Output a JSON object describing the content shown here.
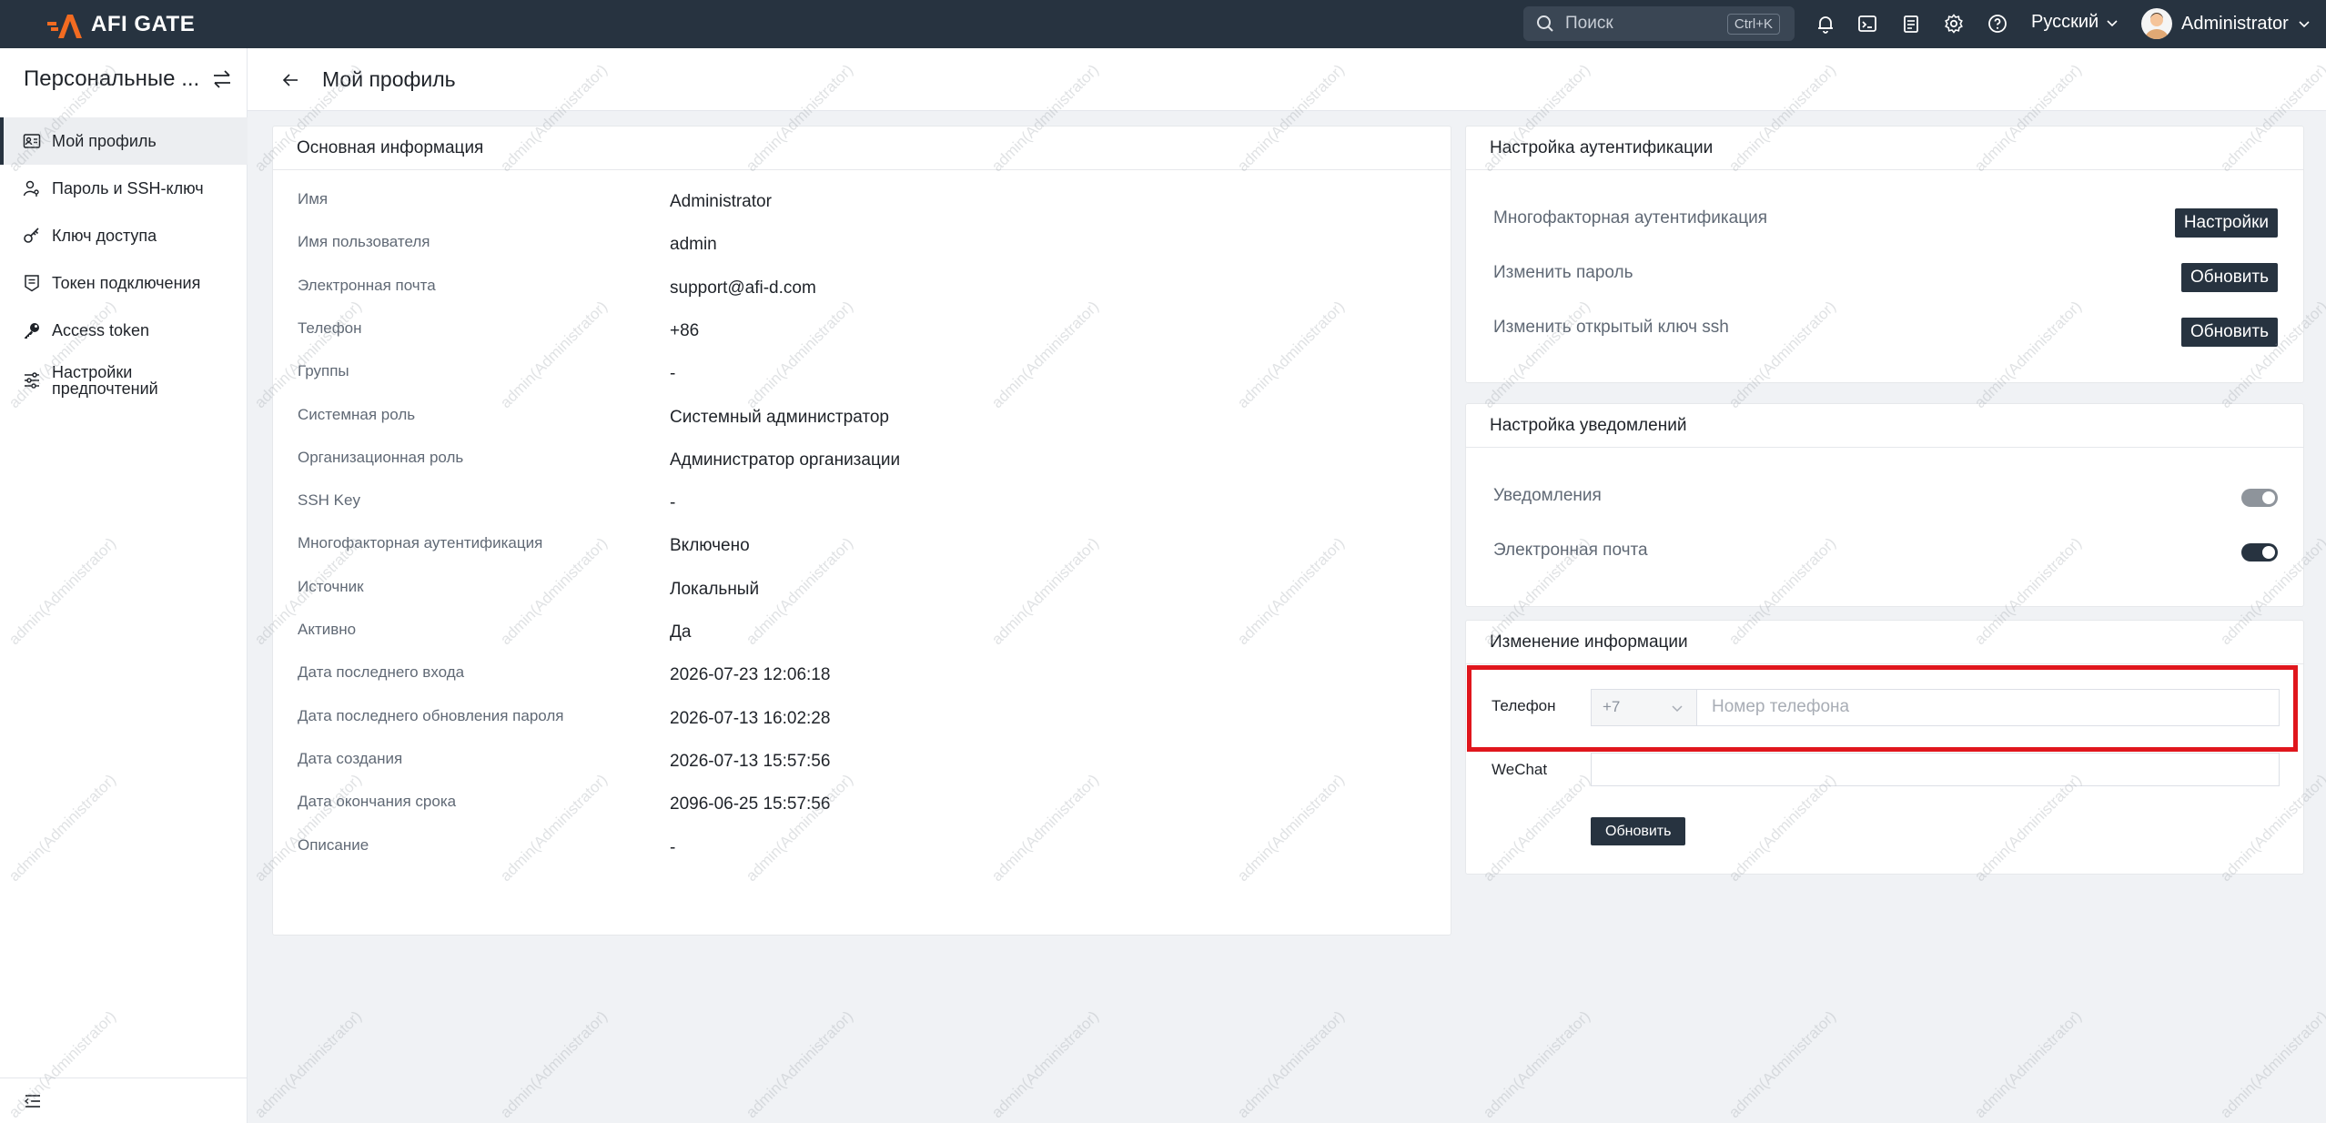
{
  "brand": {
    "name": "AFI GATE",
    "accent": "#f26b21"
  },
  "topbar": {
    "search_placeholder": "Поиск",
    "search_shortcut": "Ctrl+K",
    "language": "Русский",
    "user_name": "Administrator",
    "icons": [
      "bell-icon",
      "terminal-icon",
      "clipboard-icon",
      "gear-icon",
      "help-icon"
    ]
  },
  "sidebar": {
    "title": "Персональные ...",
    "items": [
      {
        "label": "Мой профиль",
        "icon": "profile-card-icon",
        "active": true
      },
      {
        "label": "Пароль и SSH-ключ",
        "icon": "user-key-icon"
      },
      {
        "label": "Ключ доступа",
        "icon": "key-icon"
      },
      {
        "label": "Токен подключения",
        "icon": "token-icon"
      },
      {
        "label": "Access token",
        "icon": "key-solid-icon"
      },
      {
        "label": "Настройки предпочтений",
        "icon": "sliders-icon"
      }
    ]
  },
  "page": {
    "title": "Мой профиль"
  },
  "basic_info": {
    "title": "Основная информация",
    "rows": [
      {
        "label": "Имя",
        "value": "Administrator"
      },
      {
        "label": "Имя пользователя",
        "value": "admin"
      },
      {
        "label": "Электронная почта",
        "value": "support@afi-d.com"
      },
      {
        "label": "Телефон",
        "value": "+86"
      },
      {
        "label": "Группы",
        "value": "-"
      },
      {
        "label": "Системная роль",
        "value": "Системный администратор"
      },
      {
        "label": "Организационная роль",
        "value": "Администратор организации"
      },
      {
        "label": "SSH Key",
        "value": "-"
      },
      {
        "label": "Многофакторная аутентификация",
        "value": "Включено"
      },
      {
        "label": "Источник",
        "value": "Локальный"
      },
      {
        "label": "Активно",
        "value": "Да"
      },
      {
        "label": "Дата последнего входа",
        "value": "2026-07-23 12:06:18"
      },
      {
        "label": "Дата последнего обновления пароля",
        "value": "2026-07-13 16:02:28"
      },
      {
        "label": "Дата создания",
        "value": "2026-07-13 15:57:56"
      },
      {
        "label": "Дата окончания срока",
        "value": "2096-06-25 15:57:56"
      },
      {
        "label": "Описание",
        "value": "-"
      }
    ]
  },
  "auth_settings": {
    "title": "Настройка аутентификации",
    "rows": [
      {
        "label": "Многофакторная аутентификация",
        "button": "Настройки"
      },
      {
        "label": "Изменить пароль",
        "button": "Обновить"
      },
      {
        "label": "Изменить открытый ключ ssh",
        "button": "Обновить"
      }
    ]
  },
  "notify_settings": {
    "title": "Настройка уведомлений",
    "rows": [
      {
        "label": "Уведомления",
        "on": true,
        "enabled": false
      },
      {
        "label": "Электронная почта",
        "on": true,
        "enabled": true
      }
    ]
  },
  "edit_info": {
    "title": "Изменение информации",
    "phone_label": "Телефон",
    "phone_prefix": "+7",
    "phone_placeholder": "Номер телефона",
    "wechat_label": "WeChat",
    "wechat_value": "",
    "submit": "Обновить"
  },
  "watermark": "admin(Administrator)"
}
